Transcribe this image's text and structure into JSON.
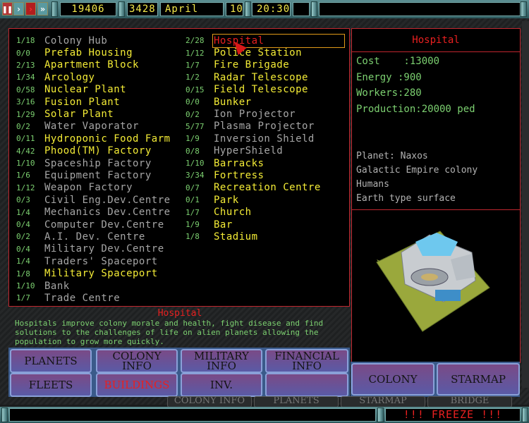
{
  "topbar": {
    "credits": "19406",
    "year": "3428",
    "month": "April",
    "day": "10",
    "time": "20:30",
    "message": ""
  },
  "buildings": {
    "left": [
      {
        "count": "1/18",
        "name": "Colony Hub",
        "state": "g"
      },
      {
        "count": "0/0",
        "name": "Prefab Housing",
        "state": "y"
      },
      {
        "count": "2/13",
        "name": "Apartment Block",
        "state": "y"
      },
      {
        "count": "1/34",
        "name": "Arcology",
        "state": "y"
      },
      {
        "count": "0/58",
        "name": "Nuclear Plant",
        "state": "y"
      },
      {
        "count": "3/16",
        "name": "Fusion Plant",
        "state": "y"
      },
      {
        "count": "1/29",
        "name": "Solar Plant",
        "state": "y"
      },
      {
        "count": "0/2",
        "name": "Water Vaporator",
        "state": "g"
      },
      {
        "count": "0/11",
        "name": "Hydroponic Food Farm",
        "state": "y"
      },
      {
        "count": "4/42",
        "name": "Phood(TM) Factory",
        "state": "y"
      },
      {
        "count": "1/10",
        "name": "Spaceship Factory",
        "state": "g"
      },
      {
        "count": "1/6",
        "name": "Equipment Factory",
        "state": "g"
      },
      {
        "count": "1/12",
        "name": "Weapon Factory",
        "state": "g"
      },
      {
        "count": "0/3",
        "name": "Civil Eng.Dev.Centre",
        "state": "g"
      },
      {
        "count": "1/4",
        "name": "Mechanics Dev.Centre",
        "state": "g"
      },
      {
        "count": "0/4",
        "name": "Computer Dev.Centre",
        "state": "g"
      },
      {
        "count": "0/2",
        "name": "A.I. Dev. Centre",
        "state": "g"
      },
      {
        "count": "0/4",
        "name": "Military Dev.Centre",
        "state": "g"
      },
      {
        "count": "1/4",
        "name": "Traders' Spaceport",
        "state": "g"
      },
      {
        "count": "1/8",
        "name": "Military Spaceport",
        "state": "y"
      },
      {
        "count": "1/10",
        "name": "Bank",
        "state": "g"
      },
      {
        "count": "1/7",
        "name": "Trade Centre",
        "state": "g"
      }
    ],
    "right": [
      {
        "count": "2/28",
        "name": "Hospital",
        "state": "sel"
      },
      {
        "count": "1/12",
        "name": "Police Station",
        "state": "y"
      },
      {
        "count": "1/7",
        "name": "Fire Brigade",
        "state": "y"
      },
      {
        "count": "1/2",
        "name": "Radar Telescope",
        "state": "y"
      },
      {
        "count": "0/15",
        "name": "Field Telescope",
        "state": "y"
      },
      {
        "count": "0/0",
        "name": "Bunker",
        "state": "y"
      },
      {
        "count": "0/2",
        "name": "Ion Projector",
        "state": "g"
      },
      {
        "count": "5/77",
        "name": "Plasma Projector",
        "state": "g"
      },
      {
        "count": "1/9",
        "name": "Inversion Shield",
        "state": "g"
      },
      {
        "count": "0/8",
        "name": "HyperShield",
        "state": "g"
      },
      {
        "count": "1/10",
        "name": "Barracks",
        "state": "y"
      },
      {
        "count": "3/34",
        "name": "Fortress",
        "state": "y"
      },
      {
        "count": "0/7",
        "name": "Recreation Centre",
        "state": "y"
      },
      {
        "count": "0/1",
        "name": "Park",
        "state": "y"
      },
      {
        "count": "1/7",
        "name": "Church",
        "state": "y"
      },
      {
        "count": "1/9",
        "name": "Bar",
        "state": "y"
      },
      {
        "count": "1/8",
        "name": "Stadium",
        "state": "y"
      }
    ]
  },
  "description": {
    "title": "Hospital",
    "text": "Hospitals improve colony morale and health, fight disease and find solutions to the challenges of life on alien planets allowing the population to grow more quickly."
  },
  "info": {
    "title": "Hospital",
    "cost": "Cost    :13000",
    "energy": "Energy :900",
    "workers": "Workers:280",
    "production": "Production:20000 ped",
    "planet": "Planet: Naxos",
    "owner": "Galactic Empire colony",
    "race": "Humans",
    "surface": "Earth type surface"
  },
  "buttons": {
    "planets": "PLANETS",
    "colony_info_1": "COLONY",
    "colony_info_2": "INFO",
    "military_info_1": "MILITARY",
    "military_info_2": "INFO",
    "financial_info_1": "FINANCIAL",
    "financial_info_2": "INFO",
    "fleets": "FLEETS",
    "buildings": "BUILDINGS",
    "inv": "INV.",
    "colony": "COLONY",
    "starmap": "STARMAP"
  },
  "under_buttons": [
    "COLONY INFO",
    "PLANETS",
    "STARMAP",
    "BRIDGE"
  ],
  "status": {
    "freeze": "!!! FREEZE !!!"
  }
}
